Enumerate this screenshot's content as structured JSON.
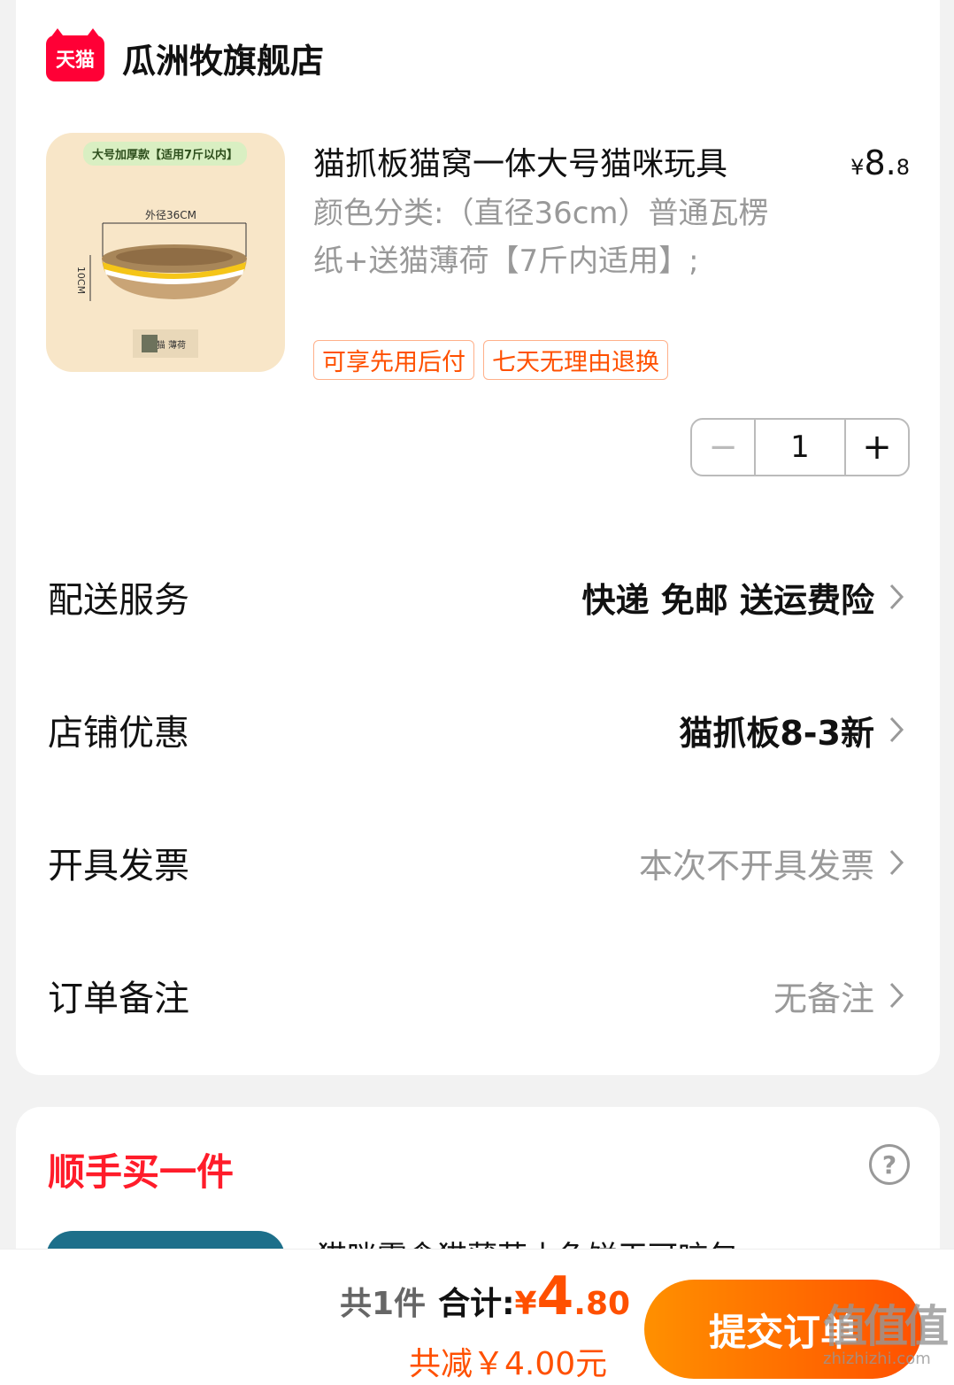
{
  "shop": {
    "logo_text": "天猫",
    "name": "瓜洲牧旗舰店"
  },
  "product": {
    "title": "猫抓板猫窝一体大号猫咪玩具",
    "price_yen": "¥",
    "price_main": "8.",
    "price_minor": "8",
    "spec": "颜色分类:（直径36cm）普通瓦楞纸+送猫薄荷【7斤内适用】;",
    "badges": [
      "可享先用后付",
      "七天无理由退换"
    ],
    "image": {
      "tag": "大号加厚款【适用7斤以内】",
      "diameter_label": "外径36CM",
      "height_label": "10CM",
      "mini_tag": "猫 薄荷"
    },
    "quantity": "1",
    "minus_symbol": "−",
    "plus_symbol": "+"
  },
  "rows": [
    {
      "label": "配送服务",
      "value": "快递 免邮 送运费险"
    },
    {
      "label": "店铺优惠",
      "value": "猫抓板8-3新"
    },
    {
      "label": "开具发票",
      "value": "本次不开具发票"
    },
    {
      "label": "订单备注",
      "value": "无备注"
    }
  ],
  "addon": {
    "title": "顺手买一件",
    "help_symbol": "?",
    "item_name": "猫咪零食猫薄荷小鱼饼干可咬包"
  },
  "footer": {
    "count": "共1件",
    "total_label": "合计:",
    "total_yen": "¥",
    "total_int": "4",
    "total_dec": ".80",
    "saved": "共减￥4.00元",
    "submit": "提交订单"
  },
  "watermark": {
    "big": "值值值",
    "small": "zhizhizhi.com"
  },
  "colors": {
    "accent": "#ff5000",
    "tmall_red": "#ff0036",
    "title_red": "#ff1c2a",
    "muted": "#999999"
  }
}
